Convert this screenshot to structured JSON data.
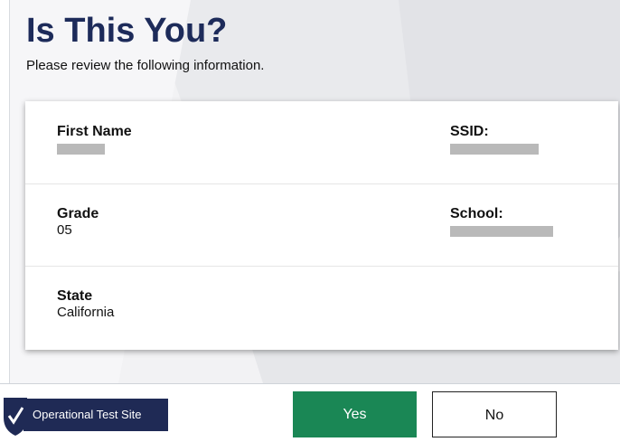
{
  "header": {
    "title": "Is This You?",
    "subtitle": "Please review the following information."
  },
  "student": {
    "first_name_label": "First Name",
    "first_name_value": "",
    "ssid_label": "SSID:",
    "ssid_value": "",
    "grade_label": "Grade",
    "grade_value": "05",
    "school_label": "School:",
    "school_value": "",
    "state_label": "State",
    "state_value": "California"
  },
  "footer": {
    "site_label": "Operational Test Site",
    "yes_label": "Yes",
    "no_label": "No"
  },
  "colors": {
    "title": "#1d2b5a",
    "yes_button": "#1a8755",
    "site_badge": "#1f2a55"
  },
  "icons": {
    "logo": "shield-check-logo"
  }
}
